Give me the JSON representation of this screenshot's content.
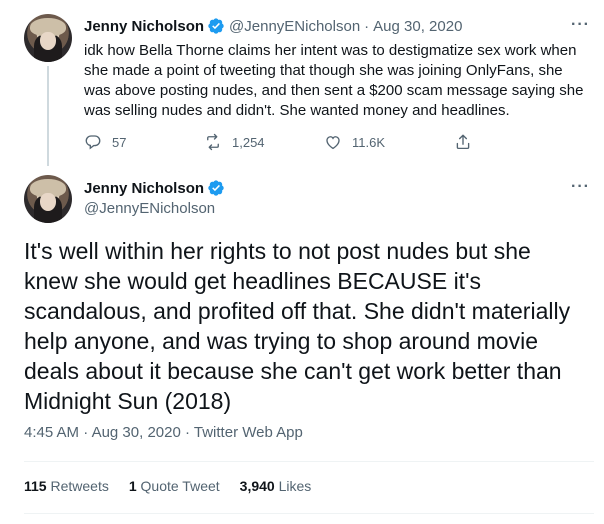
{
  "tweet1": {
    "name": "Jenny Nicholson",
    "handle": "@JennyENicholson",
    "separator": "·",
    "date": "Aug 30, 2020",
    "more": "···",
    "lines": [
      "idk how Bella Thorne claims her intent was to destigmatize sex work when",
      "she made a point of tweeting that though she was joining OnlyFans, she",
      "was above posting nudes, and then sent a $200 scam message saying she",
      "was selling nudes and didn't. She wanted money and headlines."
    ],
    "replies": "57",
    "retweets": "1,254",
    "likes": "11.6K"
  },
  "tweet2": {
    "name": "Jenny Nicholson",
    "handle": "@JennyENicholson",
    "more": "···",
    "lines": [
      "It's well within her rights to not post nudes but she",
      "knew she would get headlines BECAUSE it's",
      "scandalous, and profited off that. She didn't materially",
      "help anyone, and was trying to shop around movie",
      "deals about it because she can't get work better than",
      "Midnight Sun (2018)"
    ],
    "time": "4:45 AM",
    "separator": "·",
    "date": "Aug 30, 2020",
    "source": "Twitter Web App",
    "retweets_count": "115",
    "retweets_label": "Retweets",
    "quotes_count": "1",
    "quotes_label": "Quote Tweet",
    "likes_count": "3,940",
    "likes_label": "Likes"
  },
  "colors": {
    "verified_blue": "#1d9bf0",
    "text": "#0f1419",
    "muted": "#536471",
    "divider": "#eff3f4"
  },
  "icons": [
    "verified-icon",
    "reply-icon",
    "retweet-icon",
    "like-icon",
    "share-icon",
    "more-icon"
  ]
}
